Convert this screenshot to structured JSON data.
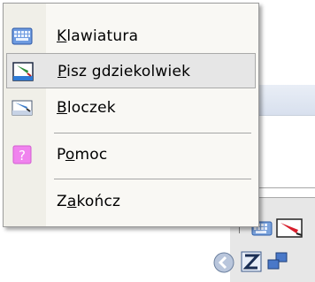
{
  "menu": {
    "items": [
      {
        "id": "klawiatura",
        "prefix": "",
        "mnemonic": "K",
        "suffix": "lawiatura",
        "icon": "keyboard-icon",
        "selected": false
      },
      {
        "id": "pisz",
        "prefix": "",
        "mnemonic": "P",
        "suffix": "isz gdziekolwiek",
        "icon": "write-anywhere-icon",
        "selected": true
      },
      {
        "id": "bloczek",
        "prefix": "",
        "mnemonic": "B",
        "suffix": "loczek",
        "icon": "writing-pad-icon",
        "selected": false
      },
      {
        "id": "pomoc",
        "prefix": "P",
        "mnemonic": "o",
        "suffix": "moc",
        "icon": "help-icon",
        "selected": false
      },
      {
        "id": "zakoncz",
        "prefix": "Z",
        "mnemonic": "a",
        "suffix": "kończ",
        "icon": "",
        "selected": false
      }
    ]
  },
  "tray": {
    "icons": [
      "keyboard-icon",
      "pen-icon",
      "back-arrow-icon",
      "text-input-icon",
      "network-icon"
    ]
  },
  "colors": {
    "menu_bg": "#f9f8f4",
    "selection_bg": "#e6e6e6",
    "selection_border": "#a9a9a9",
    "help_pink": "#ee82ee"
  }
}
